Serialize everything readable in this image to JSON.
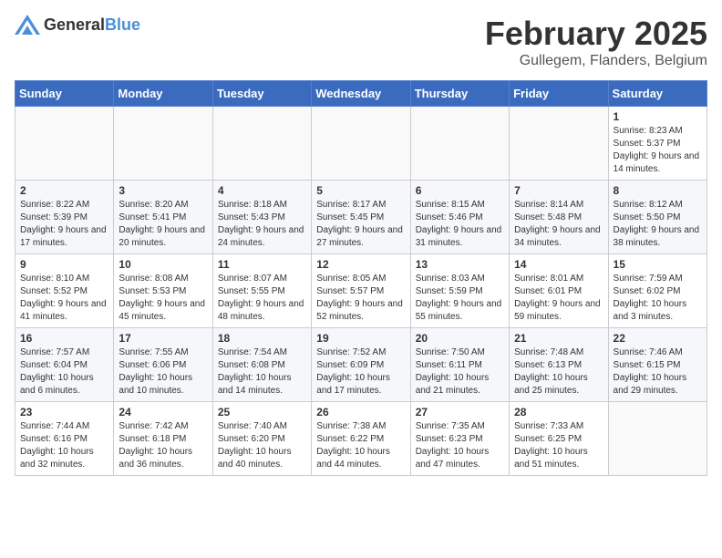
{
  "header": {
    "logo": {
      "general": "General",
      "blue": "Blue"
    },
    "title": "February 2025",
    "location": "Gullegem, Flanders, Belgium"
  },
  "days_of_week": [
    "Sunday",
    "Monday",
    "Tuesday",
    "Wednesday",
    "Thursday",
    "Friday",
    "Saturday"
  ],
  "weeks": [
    [
      {
        "day": "",
        "info": ""
      },
      {
        "day": "",
        "info": ""
      },
      {
        "day": "",
        "info": ""
      },
      {
        "day": "",
        "info": ""
      },
      {
        "day": "",
        "info": ""
      },
      {
        "day": "",
        "info": ""
      },
      {
        "day": "1",
        "info": "Sunrise: 8:23 AM\nSunset: 5:37 PM\nDaylight: 9 hours and 14 minutes."
      }
    ],
    [
      {
        "day": "2",
        "info": "Sunrise: 8:22 AM\nSunset: 5:39 PM\nDaylight: 9 hours and 17 minutes."
      },
      {
        "day": "3",
        "info": "Sunrise: 8:20 AM\nSunset: 5:41 PM\nDaylight: 9 hours and 20 minutes."
      },
      {
        "day": "4",
        "info": "Sunrise: 8:18 AM\nSunset: 5:43 PM\nDaylight: 9 hours and 24 minutes."
      },
      {
        "day": "5",
        "info": "Sunrise: 8:17 AM\nSunset: 5:45 PM\nDaylight: 9 hours and 27 minutes."
      },
      {
        "day": "6",
        "info": "Sunrise: 8:15 AM\nSunset: 5:46 PM\nDaylight: 9 hours and 31 minutes."
      },
      {
        "day": "7",
        "info": "Sunrise: 8:14 AM\nSunset: 5:48 PM\nDaylight: 9 hours and 34 minutes."
      },
      {
        "day": "8",
        "info": "Sunrise: 8:12 AM\nSunset: 5:50 PM\nDaylight: 9 hours and 38 minutes."
      }
    ],
    [
      {
        "day": "9",
        "info": "Sunrise: 8:10 AM\nSunset: 5:52 PM\nDaylight: 9 hours and 41 minutes."
      },
      {
        "day": "10",
        "info": "Sunrise: 8:08 AM\nSunset: 5:53 PM\nDaylight: 9 hours and 45 minutes."
      },
      {
        "day": "11",
        "info": "Sunrise: 8:07 AM\nSunset: 5:55 PM\nDaylight: 9 hours and 48 minutes."
      },
      {
        "day": "12",
        "info": "Sunrise: 8:05 AM\nSunset: 5:57 PM\nDaylight: 9 hours and 52 minutes."
      },
      {
        "day": "13",
        "info": "Sunrise: 8:03 AM\nSunset: 5:59 PM\nDaylight: 9 hours and 55 minutes."
      },
      {
        "day": "14",
        "info": "Sunrise: 8:01 AM\nSunset: 6:01 PM\nDaylight: 9 hours and 59 minutes."
      },
      {
        "day": "15",
        "info": "Sunrise: 7:59 AM\nSunset: 6:02 PM\nDaylight: 10 hours and 3 minutes."
      }
    ],
    [
      {
        "day": "16",
        "info": "Sunrise: 7:57 AM\nSunset: 6:04 PM\nDaylight: 10 hours and 6 minutes."
      },
      {
        "day": "17",
        "info": "Sunrise: 7:55 AM\nSunset: 6:06 PM\nDaylight: 10 hours and 10 minutes."
      },
      {
        "day": "18",
        "info": "Sunrise: 7:54 AM\nSunset: 6:08 PM\nDaylight: 10 hours and 14 minutes."
      },
      {
        "day": "19",
        "info": "Sunrise: 7:52 AM\nSunset: 6:09 PM\nDaylight: 10 hours and 17 minutes."
      },
      {
        "day": "20",
        "info": "Sunrise: 7:50 AM\nSunset: 6:11 PM\nDaylight: 10 hours and 21 minutes."
      },
      {
        "day": "21",
        "info": "Sunrise: 7:48 AM\nSunset: 6:13 PM\nDaylight: 10 hours and 25 minutes."
      },
      {
        "day": "22",
        "info": "Sunrise: 7:46 AM\nSunset: 6:15 PM\nDaylight: 10 hours and 29 minutes."
      }
    ],
    [
      {
        "day": "23",
        "info": "Sunrise: 7:44 AM\nSunset: 6:16 PM\nDaylight: 10 hours and 32 minutes."
      },
      {
        "day": "24",
        "info": "Sunrise: 7:42 AM\nSunset: 6:18 PM\nDaylight: 10 hours and 36 minutes."
      },
      {
        "day": "25",
        "info": "Sunrise: 7:40 AM\nSunset: 6:20 PM\nDaylight: 10 hours and 40 minutes."
      },
      {
        "day": "26",
        "info": "Sunrise: 7:38 AM\nSunset: 6:22 PM\nDaylight: 10 hours and 44 minutes."
      },
      {
        "day": "27",
        "info": "Sunrise: 7:35 AM\nSunset: 6:23 PM\nDaylight: 10 hours and 47 minutes."
      },
      {
        "day": "28",
        "info": "Sunrise: 7:33 AM\nSunset: 6:25 PM\nDaylight: 10 hours and 51 minutes."
      },
      {
        "day": "",
        "info": ""
      }
    ]
  ]
}
